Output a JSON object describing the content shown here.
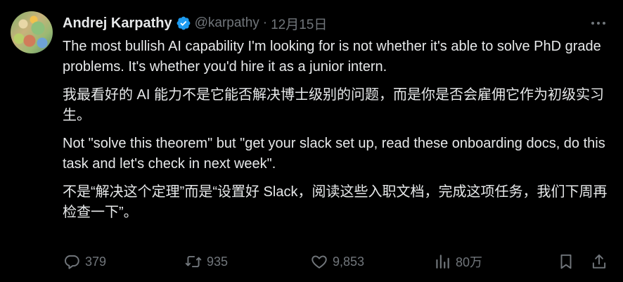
{
  "author": {
    "name": "Andrej Karpathy",
    "handle": "@karpathy",
    "separator": "·",
    "date": "12月15日"
  },
  "tweet": {
    "paragraphs": [
      "The most bullish AI capability I'm looking for is not whether it's able to solve PhD grade problems. It's whether you'd hire it as a junior intern.",
      "我最看好的 AI 能力不是它能否解决博士级别的问题，而是你是否会雇佣它作为初级实习生。",
      "Not \"solve this theorem\" but \"get your slack set up, read these onboarding docs, do this task and let's check in next week\".",
      "不是“解决这个定理”而是“设置好 Slack，阅读这些入职文档，完成这项任务，我们下周再检查一下”。"
    ]
  },
  "actions": {
    "replies": "379",
    "retweets": "935",
    "likes": "9,853",
    "views": "80万"
  },
  "icons": {
    "verified": "verified-badge-icon",
    "more": "more-dots-icon",
    "reply": "reply-icon",
    "retweet": "retweet-icon",
    "like": "heart-icon",
    "views": "views-bar-chart-icon",
    "bookmark": "bookmark-icon",
    "share": "share-icon"
  },
  "colors": {
    "background": "#000000",
    "text": "#e7e9ea",
    "muted": "#71767b",
    "verified": "#1d9bf0"
  }
}
